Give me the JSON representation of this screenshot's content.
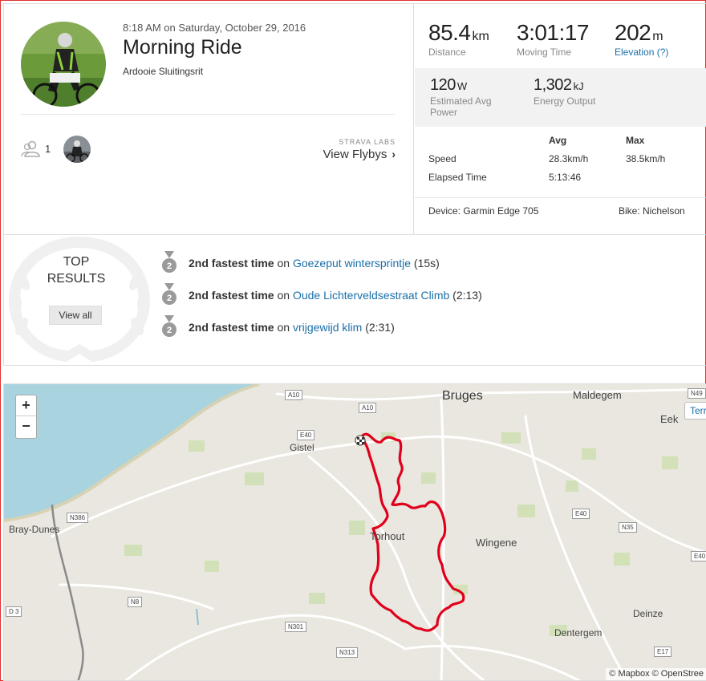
{
  "activity": {
    "datetime": "8:18 AM on Saturday, October 29, 2016",
    "title": "Morning Ride",
    "description": "Ardooie Sluitingsrit"
  },
  "athletes": {
    "count": "1"
  },
  "flybys": {
    "tag": "STRAVA LABS",
    "label": "View Flybys",
    "chevron": "›"
  },
  "stats": {
    "distance": {
      "value": "85.4",
      "unit": "km",
      "label": "Distance"
    },
    "moving_time": {
      "value": "3:01:17",
      "label": "Moving Time"
    },
    "elevation": {
      "value": "202",
      "unit": "m",
      "label": "Elevation (?)"
    },
    "power": {
      "value": "120",
      "unit": "W",
      "label_line1": "Estimated Avg",
      "label_line2": "Power"
    },
    "energy": {
      "value": "1,302",
      "unit": "kJ",
      "label": "Energy Output"
    }
  },
  "table": {
    "headers": [
      "",
      "Avg",
      "Max"
    ],
    "rows": [
      {
        "label": "Speed",
        "avg": "28.3km/h",
        "max": "38.5km/h"
      },
      {
        "label": "Elapsed Time",
        "avg": "5:13:46",
        "max": ""
      }
    ]
  },
  "device": "Device: Garmin Edge 705",
  "bike": "Bike: Nichelson",
  "results": {
    "heading_line1": "TOP",
    "heading_line2": "RESULTS",
    "view_all": "View all",
    "medal_rank": "2",
    "items": [
      {
        "rank_text": "2nd fastest time",
        "on": "on",
        "segment": "Goezeput wintersprintje",
        "time": "(15s)"
      },
      {
        "rank_text": "2nd fastest time",
        "on": "on",
        "segment": "Oude Lichterveldsestraat Climb",
        "time": "(2:13)"
      },
      {
        "rank_text": "2nd fastest time",
        "on": "on",
        "segment": "vrijgewijd klim",
        "time": "(2:31)"
      }
    ]
  },
  "map": {
    "zoom_in": "+",
    "zoom_out": "−",
    "terrain": "Terr",
    "attribution": "© Mapbox © OpenStree",
    "places": {
      "bruges": "Bruges",
      "maldegem": "Maldegem",
      "eek": "Eek",
      "gistel": "Gistel",
      "bray_dunes": "Bray-Dunes",
      "torhout": "Torhout",
      "wingene": "Wingene",
      "deinze": "Deinze",
      "dentergem": "Dentergem"
    },
    "roads": {
      "a10a": "A10",
      "a10b": "A10",
      "e40a": "E40",
      "e40b": "E40",
      "e40c": "E40",
      "n49": "N49",
      "n386": "N386",
      "n8": "N8",
      "d3": "D 3",
      "n301": "N301",
      "n313": "N313",
      "n35": "N35",
      "e17": "E17"
    },
    "route_color": "#e0001b",
    "sea_color": "#a9d3df"
  }
}
